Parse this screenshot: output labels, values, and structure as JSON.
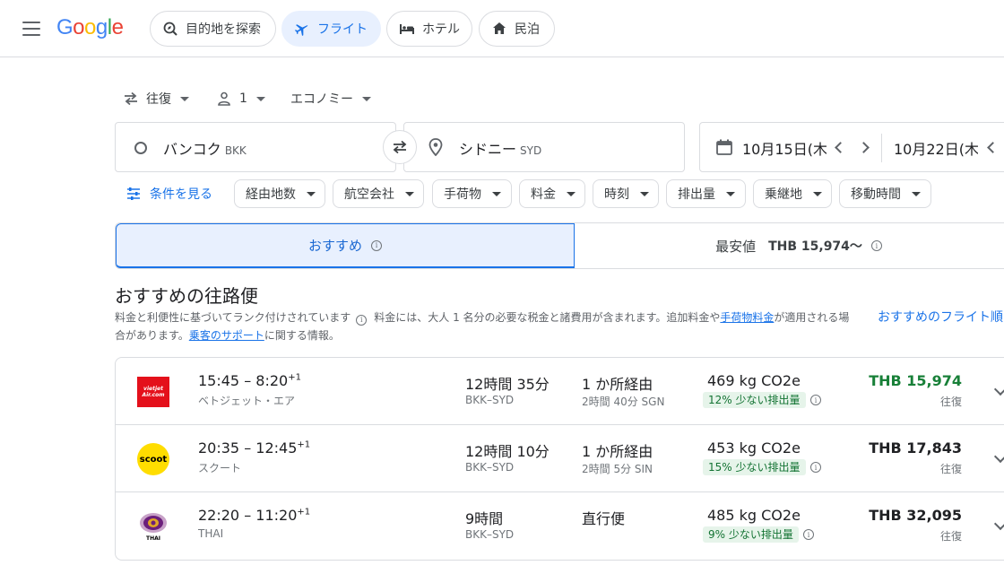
{
  "header": {
    "logo": [
      "G",
      "o",
      "o",
      "g",
      "l",
      "e"
    ],
    "nav": [
      {
        "label": "目的地を探索",
        "icon": "explore-icon"
      },
      {
        "label": "フライト",
        "icon": "flight-icon"
      },
      {
        "label": "ホテル",
        "icon": "hotel-icon"
      },
      {
        "label": "民泊",
        "icon": "home-icon"
      }
    ]
  },
  "search": {
    "trip_type": "往復",
    "passengers": "1",
    "cabin": "エコノミー",
    "origin": {
      "name": "バンコク",
      "code": "BKK"
    },
    "destination": {
      "name": "シドニー",
      "code": "SYD"
    },
    "depart_date": "10月15日(木",
    "return_date": "10月22日(木"
  },
  "filters": {
    "more_label": "条件を見る",
    "chips": [
      "経由地数",
      "航空会社",
      "手荷物",
      "料金",
      "時刻",
      "排出量",
      "乗継地",
      "移動時間"
    ]
  },
  "tabs": {
    "best": "おすすめ",
    "cheapest_label": "最安値",
    "cheapest_price": "THB 15,974～"
  },
  "section": {
    "title": "おすすめの往路便",
    "desc_1": "料金と利便性に基づいてランク付けされています",
    "desc_2": "料金には、大人 1 名分の必要な税金と諸費用が含まれます。追加料金や",
    "desc_link1": "手荷物料金",
    "desc_3": "が適用される場合があります。",
    "desc_link2": "乗客のサポート",
    "desc_4": "に関する情報。",
    "rec_link": "おすすめのフライト順"
  },
  "flights": [
    {
      "times": "15:45 – 8:20",
      "plus": "+1",
      "airline": "ベトジェット・エア",
      "duration": "12時間 35分",
      "route": "BKK–SYD",
      "stops": "1 か所経由",
      "layover": "2時間 40分 SGN",
      "co2": "469 kg CO2e",
      "badge": "12% 少ない排出量",
      "price": "THB 15,974",
      "trip": "往復",
      "price_color": "#188038"
    },
    {
      "times": "20:35 – 12:45",
      "plus": "+1",
      "airline": "スクート",
      "duration": "12時間 10分",
      "route": "BKK–SYD",
      "stops": "1 か所経由",
      "layover": "2時間 5分 SIN",
      "co2": "453 kg CO2e",
      "badge": "15% 少ない排出量",
      "price": "THB 17,843",
      "trip": "往復",
      "price_color": "#202124"
    },
    {
      "times": "22:20 – 11:20",
      "plus": "+1",
      "airline": "THAI",
      "duration": "9時間",
      "route": "BKK–SYD",
      "stops": "直行便",
      "layover": "",
      "co2": "485 kg CO2e",
      "badge": "9% 少ない排出量",
      "price": "THB 32,095",
      "trip": "往復",
      "price_color": "#202124"
    }
  ],
  "logos": {
    "vietjet": "vietjet Air.com",
    "scoot": "scoot",
    "thai": "THAI"
  }
}
